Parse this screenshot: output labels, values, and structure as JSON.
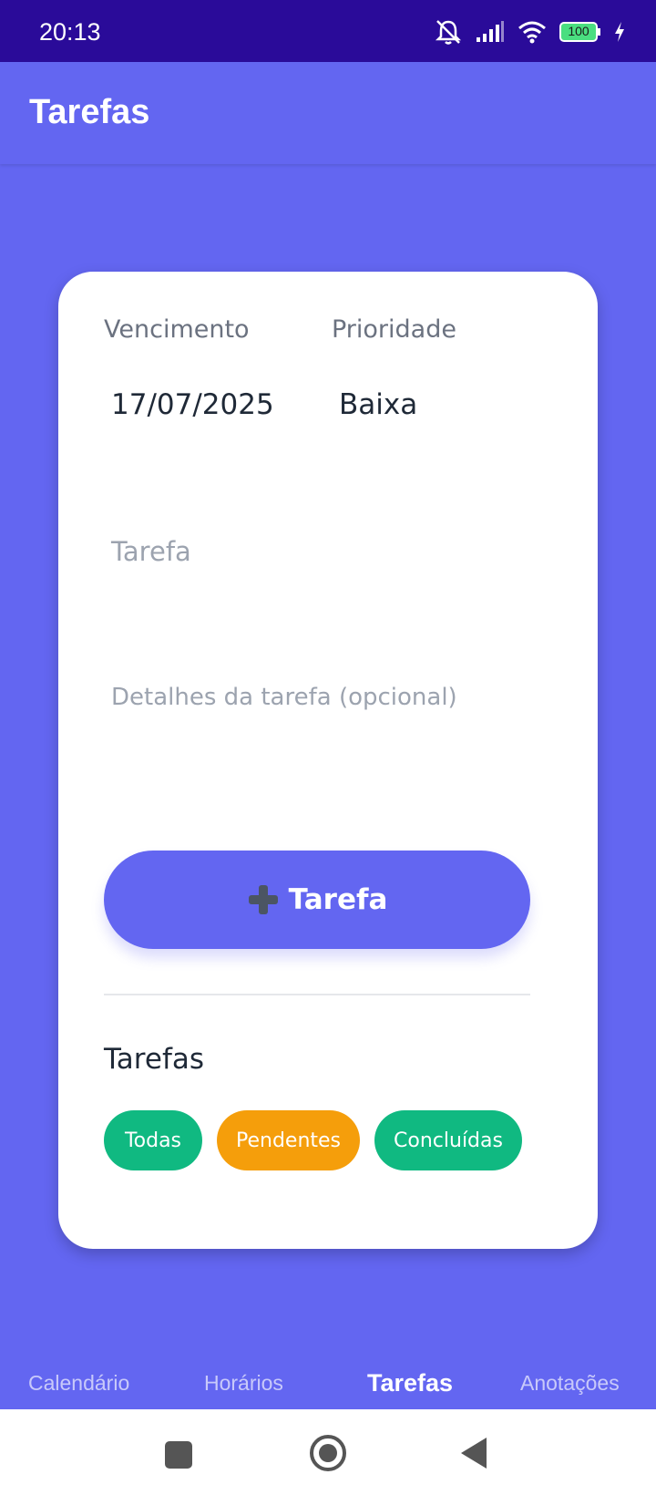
{
  "status_bar": {
    "time": "20:13",
    "battery": "100",
    "icons": [
      "mute-icon",
      "signal-icon",
      "wifi-icon",
      "battery-icon",
      "charging-icon"
    ]
  },
  "app_bar": {
    "title": "Tarefas"
  },
  "form": {
    "due_label": "Vencimento",
    "due_value": "17/07/2025",
    "priority_label": "Prioridade",
    "priority_value": "Baixa",
    "task_placeholder": "Tarefa",
    "details_placeholder": "Detalhes da tarefa (opcional)",
    "add_button_label": "Tarefa",
    "add_button_icon": "plus-icon"
  },
  "list": {
    "title": "Tarefas",
    "filters": [
      {
        "label": "Todas",
        "color": "#10b981"
      },
      {
        "label": "Pendentes",
        "color": "#f59e0b"
      },
      {
        "label": "Concluídas",
        "color": "#10b981"
      }
    ]
  },
  "bottom_nav": {
    "items": [
      {
        "label": "Calendário",
        "active": false
      },
      {
        "label": "Horários",
        "active": false
      },
      {
        "label": "Tarefas",
        "active": true
      },
      {
        "label": "Anotações",
        "active": false
      }
    ]
  },
  "colors": {
    "primary": "#6366f1",
    "status_bar": "#2a0b99",
    "success": "#10b981",
    "warning": "#f59e0b"
  }
}
